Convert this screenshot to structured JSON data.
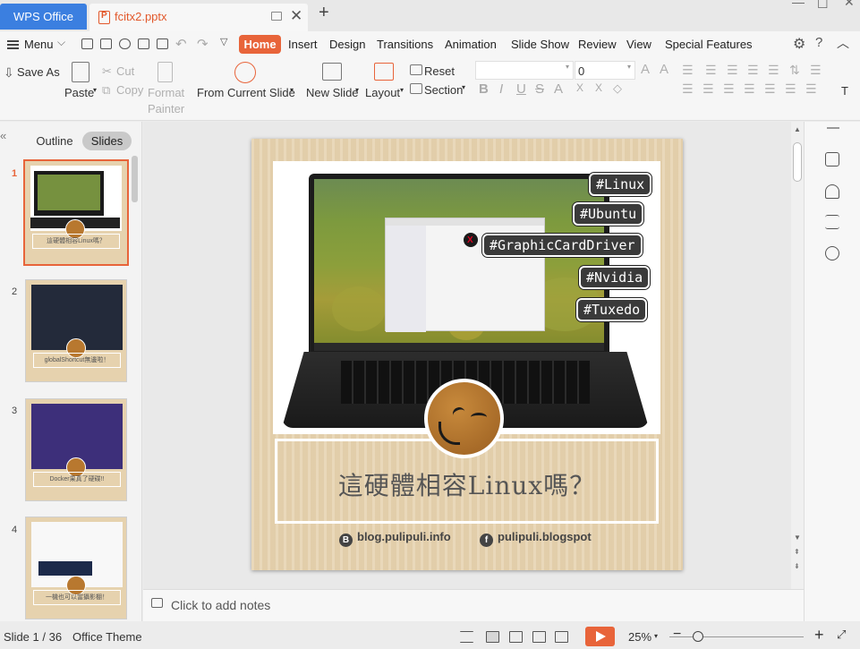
{
  "titlebar": {
    "app_tab": "WPS Office",
    "doc_tab": "fcitx2.pptx",
    "new_tab": "+"
  },
  "menubar": {
    "menu_label": "Menu",
    "tabs": [
      "Home",
      "Insert",
      "Design",
      "Transitions",
      "Animation",
      "Slide Show",
      "Review",
      "View",
      "Special Features"
    ],
    "active_tab": "Home"
  },
  "ribbon": {
    "save_as": "Save As",
    "paste": "Paste",
    "cut": "Cut",
    "copy": "Copy",
    "format_painter_1": "Format",
    "format_painter_2": "Painter",
    "from_current_slide": "From Current Slide",
    "new_slide": "New Slide",
    "layout": "Layout",
    "reset": "Reset",
    "section": "Section",
    "font_size": "0",
    "overflow_label": "T"
  },
  "left_panel": {
    "tab_outline": "Outline",
    "tab_slides": "Slides",
    "active_tab": "Slides",
    "thumbnails": [
      {
        "num": "1",
        "caption": "這硬體相容Linux嗎？",
        "selected": true
      },
      {
        "num": "2",
        "caption": "globalShortcut無邊啦！",
        "selected": false
      },
      {
        "num": "3",
        "caption": "Docker果真了硬碟!!",
        "selected": false
      },
      {
        "num": "4",
        "caption": "一機也可以當攝影棚！",
        "selected": false
      }
    ]
  },
  "slide": {
    "tags": [
      "#Linux",
      "#Ubuntu",
      "#GraphicCardDriver",
      "#Nvidia",
      "#Tuxedo"
    ],
    "caption": "這硬體相容Linux嗎？",
    "footer_left": "blog.pulipuli.info",
    "footer_right": "pulipuli.blogspot"
  },
  "notes": {
    "placeholder": "Click to add notes"
  },
  "statusbar": {
    "slide_counter": "Slide 1 / 36",
    "theme": "Office Theme",
    "zoom": "25%"
  },
  "colors": {
    "accent": "#e8643a",
    "wps_blue": "#3b7fe0",
    "tag_bg": "#3a3a3a"
  }
}
